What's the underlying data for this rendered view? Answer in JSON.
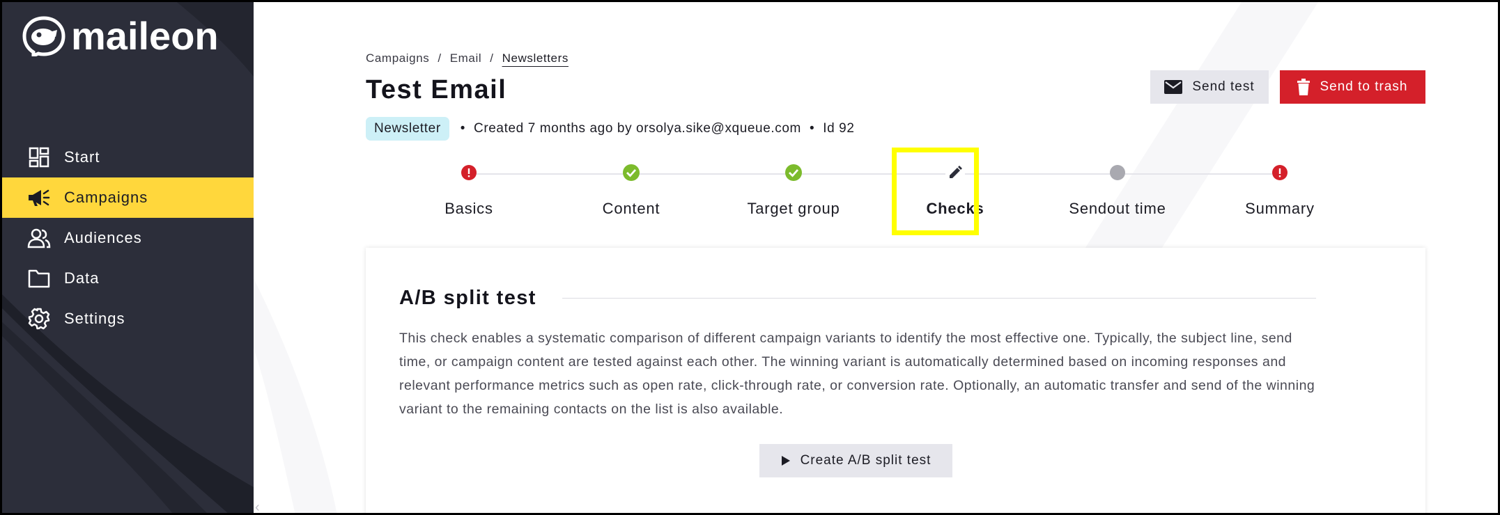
{
  "brand": {
    "name": "maileon",
    "accent": "#ffd73c",
    "sidebar_bg": "#2c2e3a",
    "danger": "#d4202a",
    "success": "#7cbb2c"
  },
  "sidebar": {
    "items": [
      {
        "label": "Start",
        "icon": "dashboard-icon"
      },
      {
        "label": "Campaigns",
        "icon": "megaphone-icon",
        "active": true
      },
      {
        "label": "Audiences",
        "icon": "users-icon"
      },
      {
        "label": "Data",
        "icon": "folder-icon"
      },
      {
        "label": "Settings",
        "icon": "gear-icon"
      }
    ]
  },
  "breadcrumb": [
    "Campaigns",
    "Email",
    "Newsletters"
  ],
  "breadcrumb_sep": "/",
  "header": {
    "title": "Test Email",
    "badge": "Newsletter",
    "created": "Created 7 months ago by orsolya.sike@xqueue.com",
    "id": "Id 92",
    "sep": "•",
    "send_test_label": "Send test",
    "trash_label": "Send to trash"
  },
  "steps": [
    {
      "label": "Basics",
      "status": "error"
    },
    {
      "label": "Content",
      "status": "done"
    },
    {
      "label": "Target group",
      "status": "done"
    },
    {
      "label": "Checks",
      "status": "editing"
    },
    {
      "label": "Sendout time",
      "status": "pending"
    },
    {
      "label": "Summary",
      "status": "error"
    }
  ],
  "card": {
    "title": "A/B split test",
    "description": "This check enables a systematic comparison of different campaign variants to identify the most effective one. Typically, the subject line, send time, or campaign content are tested against each other. The winning variant is automatically determined based on incoming responses and relevant performance metrics such as open rate, click-through rate, or conversion rate. Optionally, an automatic transfer and send of the winning variant to the remaining contacts on the list is also available.",
    "button_label": "Create A/B split test"
  }
}
